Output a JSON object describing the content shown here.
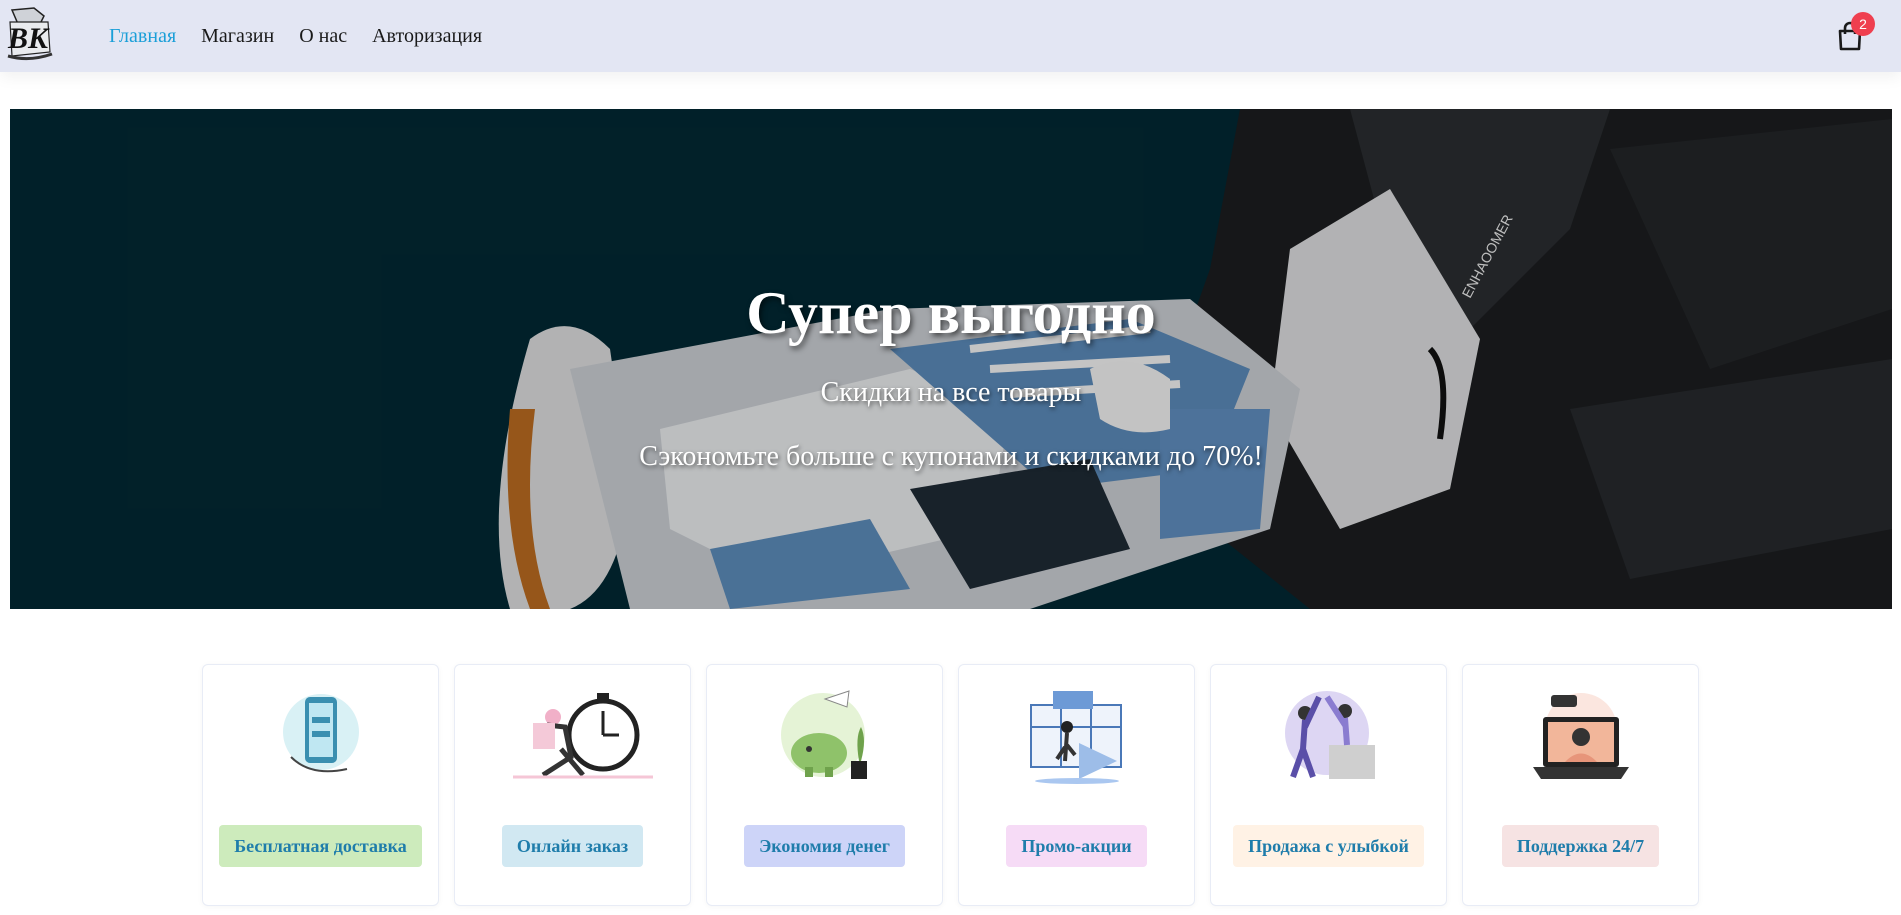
{
  "header": {
    "logo_text": "BK",
    "nav": [
      {
        "label": "Главная",
        "active": true
      },
      {
        "label": "Магазин",
        "active": false
      },
      {
        "label": "О нас",
        "active": false
      },
      {
        "label": "Авторизация",
        "active": false
      }
    ],
    "cart": {
      "icon": "shopping-bag-icon",
      "count": "2",
      "badge_color": "#ef3f4f"
    }
  },
  "hero": {
    "title": "Супер выгодно",
    "subtitle": "Скидки на все товары",
    "text": "Сэкономьте больше с купонами и скидками до 70%!"
  },
  "features": [
    {
      "label": "Бесплатная доставка",
      "icon": "phone-delivery-illustration",
      "bg": "#cdebbc"
    },
    {
      "label": "Онлайн заказ",
      "icon": "clock-runner-illustration",
      "bg": "#d1e8f2"
    },
    {
      "label": "Экономия денег",
      "icon": "piggy-bank-illustration",
      "bg": "#cdd4f8"
    },
    {
      "label": "Промо-акции",
      "icon": "promo-illustration",
      "bg": "#f6dbf6"
    },
    {
      "label": "Продажа с улыбкой",
      "icon": "high-five-illustration",
      "bg": "#fff2e5"
    },
    {
      "label": "Поддержка 24/7",
      "icon": "support-laptop-illustration",
      "bg": "#f6e3e3"
    }
  ],
  "colors": {
    "header_bg": "#e3e6f3",
    "accent": "#1b9fd8",
    "tag_text": "#1f7dab"
  }
}
